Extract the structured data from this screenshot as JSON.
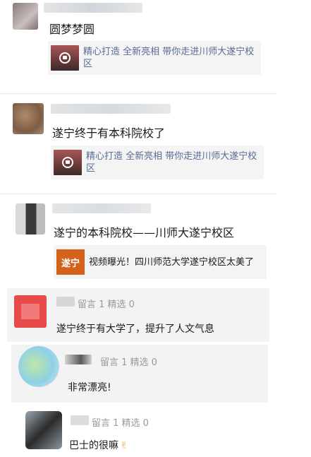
{
  "posts": [
    {
      "title": "圆梦梦圆",
      "card_text": "精心打造 全新亮相 带你走进川师大遂宁校区",
      "card_icon": "video-camera-icon"
    },
    {
      "title": "遂宁终于有本科院校了",
      "card_text": "精心打造 全新亮相 带你走进川师大遂宁校区",
      "card_icon": "video-camera-icon"
    },
    {
      "title": "遂宁的本科院校——川师大遂宁校区",
      "card_text": "视频曝光！四川师范大学遂宁校区太美了",
      "card_logo": "遂宁"
    }
  ],
  "comments": [
    {
      "meta": "留言 1 精选 0",
      "text": "遂宁终于有大学了，提升了人文气息"
    },
    {
      "meta": "留言 1 精选 0",
      "text": "非常漂亮!"
    },
    {
      "meta": "留言 1 精选 0",
      "text": "巴士的很嘛",
      "emoji": "✌"
    }
  ],
  "colors": {
    "link": "#576b95",
    "meta": "#9a9a9a",
    "card_bg": "#f4f4f4",
    "comment_bg": "#f3f3f3",
    "logo_orange": "#d4621c"
  }
}
